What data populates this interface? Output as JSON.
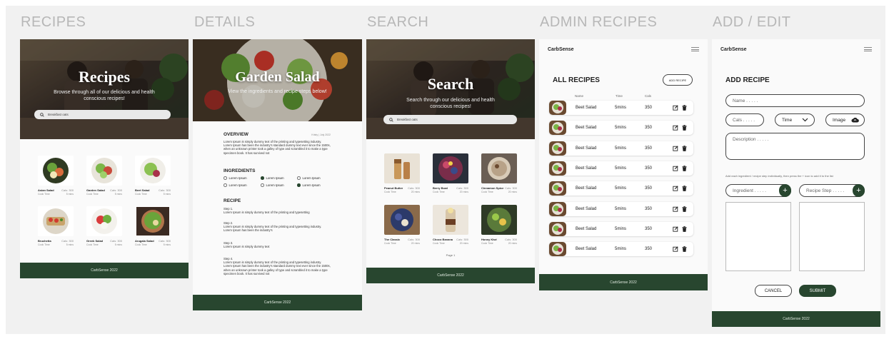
{
  "labels": {
    "recipes": "RECIPES",
    "details": "DETAILS",
    "search": "SEARCH",
    "admin": "ADMIN RECIPES",
    "add_edit": "ADD / EDIT"
  },
  "footer_text": "CarbSense 2022",
  "brand": "CarbSense",
  "colors": {
    "footer": "#28462f",
    "accent": "#28462f",
    "canvas": "#f1f1f1"
  },
  "recipes": {
    "title": "Recipes",
    "subtitle": "Browse through all of our delicious and health conscious recipes!",
    "search_placeholder": "Breakfast oats",
    "cards": [
      {
        "name": "Asian Salad",
        "meta": "Cals: 300",
        "sub_l": "Cook Time",
        "sub_r": "5 mins"
      },
      {
        "name": "Garden Salad",
        "meta": "Cals: 300",
        "sub_l": "Cook Time",
        "sub_r": "5 mins"
      },
      {
        "name": "Beet Salad",
        "meta": "Cals: 300",
        "sub_l": "Cook Time",
        "sub_r": "5 mins"
      },
      {
        "name": "Bruchetta",
        "meta": "Cals: 300",
        "sub_l": "Cook Time",
        "sub_r": "5 mins"
      },
      {
        "name": "Greek Salad",
        "meta": "Cals: 300",
        "sub_l": "Cook Time",
        "sub_r": "5 mins"
      },
      {
        "name": "Arugala Salad",
        "meta": "Cals: 300",
        "sub_l": "Cook Time",
        "sub_r": "5 mins"
      }
    ]
  },
  "details": {
    "title": "Garden Salad",
    "subtitle": "View the ingredients and recipe steps below!",
    "overview_h": "OVERVIEW",
    "overview_meta": "Kristy | July 2022",
    "overview_p": "Lorem Ipsum is simply dummy text of the printing and typesetting industry. Lorem Ipsum has been the industry's standard dummy text ever since the 1500s, when an unknown printer took a galley of type and scrambled it to make a type specimen book. It has survived not",
    "ingredients_h": "INGREDIENTS",
    "ingredients": [
      "Lorem Ipsum",
      "Lorem Ipsum",
      "Lorem Ipsum",
      "Lorem Ipsum",
      "Lorem Ipsum",
      "Lorem Ipsum"
    ],
    "recipe_h": "RECIPE",
    "steps": [
      {
        "label": "Step 1.",
        "text": "Lorem Ipsum is simply dummy text of the printing and typesetting"
      },
      {
        "label": "Step 2.",
        "text": "Lorem Ipsum is simply dummy text of the printing and typesetting industry. Lorem Ipsum has been the industry's"
      },
      {
        "label": "Step 3.",
        "text": "Lorem Ipsum is simply dummy text"
      },
      {
        "label": "Step 4.",
        "text": "Lorem Ipsum is simply dummy text of the printing and typesetting industry. Lorem Ipsum has been the industry's standard dummy text ever since the 1500s, when an unknown printer took a galley of type and scrambled it to make a type specimen book. It has survived not"
      }
    ]
  },
  "search": {
    "title": "Search",
    "subtitle": "Search through our delicious and health conscious recipes!",
    "search_value": "Breakfast oats",
    "cards": [
      {
        "name": "Peanut Butter",
        "meta": "Cals: 300",
        "sub_l": "Cook Time",
        "sub_r": "20 mins"
      },
      {
        "name": "Berry Bowl",
        "meta": "Cals: 300",
        "sub_l": "Cook Time",
        "sub_r": "20 mins"
      },
      {
        "name": "Cinnamon Spice",
        "meta": "Cals: 300",
        "sub_l": "Cook Time",
        "sub_r": "20 mins"
      },
      {
        "name": "The Classic",
        "meta": "Cals: 300",
        "sub_l": "Cook Time",
        "sub_r": "20 mins"
      },
      {
        "name": "Choco Banana",
        "meta": "Cals: 300",
        "sub_l": "Cook Time",
        "sub_r": "20 mins"
      },
      {
        "name": "Honey Kiwi",
        "meta": "Cals: 300",
        "sub_l": "Cook Time",
        "sub_r": "20 mins"
      }
    ],
    "page": "Page 1"
  },
  "admin": {
    "title": "ALL RECIPES",
    "add_button": "ADD RECIPE",
    "columns": [
      "Name",
      "Time",
      "Cals"
    ],
    "rows": [
      {
        "name": "Beet Salad",
        "time": "5mins",
        "cals": "350"
      },
      {
        "name": "Beet Salad",
        "time": "5mins",
        "cals": "350"
      },
      {
        "name": "Beet Salad",
        "time": "5mins",
        "cals": "350"
      },
      {
        "name": "Beet Salad",
        "time": "5mins",
        "cals": "350"
      },
      {
        "name": "Beet Salad",
        "time": "5mins",
        "cals": "350"
      },
      {
        "name": "Beet Salad",
        "time": "5mins",
        "cals": "350"
      },
      {
        "name": "Beet Salad",
        "time": "5mins",
        "cals": "350"
      },
      {
        "name": "Beet Salad",
        "time": "5mins",
        "cals": "350"
      }
    ]
  },
  "add": {
    "title": "ADD RECIPE",
    "name_placeholder": "Name . . . . .",
    "cals_placeholder": "Cals . . . . .",
    "time_label": "Time",
    "image_label": "Image",
    "description_placeholder": "Description . . . . .",
    "hint": "Add each ingredient / recipe step individually, then press the + icon to add it to the list",
    "ingredient_placeholder": "Ingredient . . . . .",
    "step_placeholder": "Recipe Step . . . . .",
    "cancel": "CANCEL",
    "submit": "SUBMIT"
  }
}
